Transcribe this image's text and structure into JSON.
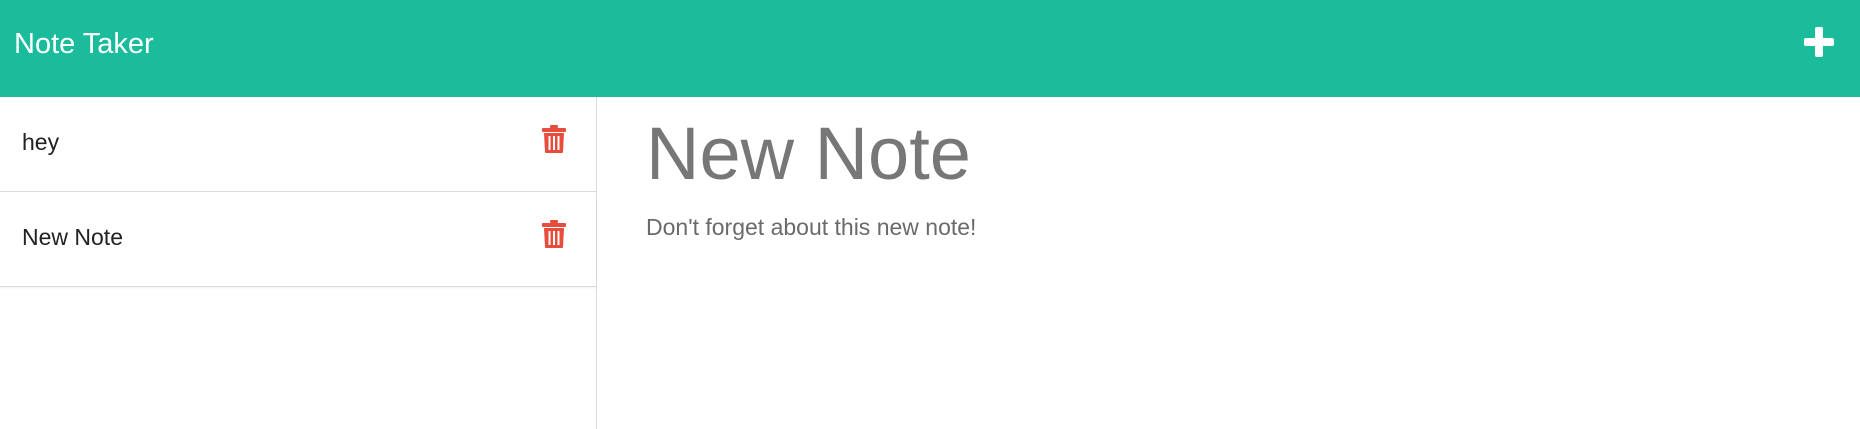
{
  "app": {
    "title": "Note Taker",
    "new_note_icon": "plus-icon"
  },
  "colors": {
    "navbar": "#1abc9c",
    "trash": "#e74c3c",
    "heading": "#777777",
    "text": "#6a6a6a"
  },
  "notes": [
    {
      "title": "hey",
      "delete_icon": "trash-icon"
    },
    {
      "title": "New Note",
      "delete_icon": "trash-icon"
    }
  ],
  "active_note": {
    "title": "New Note",
    "text": "Don't forget about this new note!"
  }
}
